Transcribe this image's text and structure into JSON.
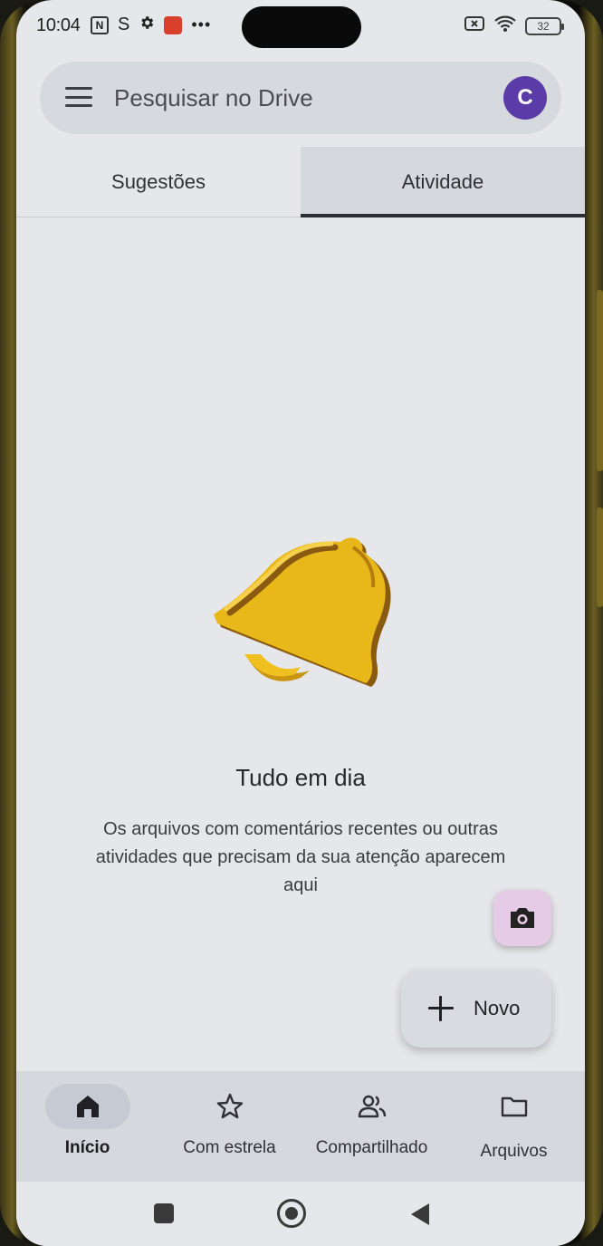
{
  "status_bar": {
    "time": "10:04",
    "nfc_glyph": "N",
    "app_glyph": "S",
    "battery_level": "32",
    "icons": [
      "nfc-icon",
      "app-notification-icon",
      "gear-icon",
      "mail-notification-icon",
      "more-dots-icon",
      "sim-off-icon",
      "wifi-icon",
      "battery-icon"
    ]
  },
  "search": {
    "placeholder": "Pesquisar no Drive",
    "avatar_initial": "C",
    "avatar_color": "#5b3ba8"
  },
  "tabs": [
    {
      "label": "Sugestões",
      "active": false
    },
    {
      "label": "Atividade",
      "active": true
    }
  ],
  "empty_state": {
    "icon": "bell-icon",
    "title": "Tudo em dia",
    "description": "Os arquivos com comentários recentes ou outras atividades que precisam da sua atenção aparecem aqui"
  },
  "fab": {
    "scan_icon": "camera-icon",
    "new_label": "Novo",
    "scan_color": "#e6cbe6"
  },
  "bottom_nav": [
    {
      "label": "Início",
      "icon": "home-icon",
      "active": true
    },
    {
      "label": "Com estrela",
      "icon": "star-icon",
      "active": false
    },
    {
      "label": "Compartilhado",
      "icon": "shared-people-icon",
      "active": false
    },
    {
      "label": "Arquivos",
      "icon": "folder-icon",
      "active": false
    }
  ],
  "colors": {
    "background": "#e6e7ea",
    "bell_gold": "#e8b81a",
    "bell_dark": "#8a5a10"
  }
}
